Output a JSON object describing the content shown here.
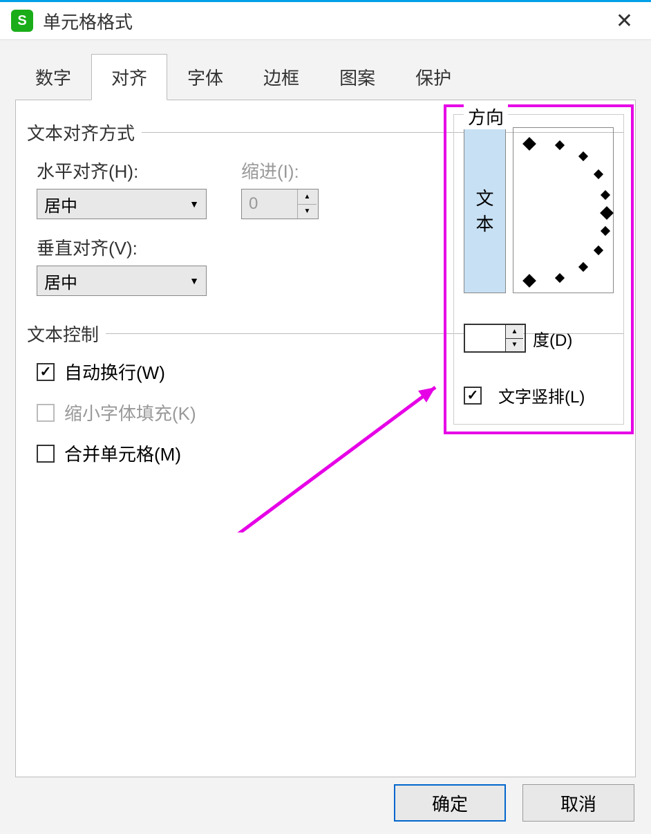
{
  "titlebar": {
    "app_icon_letter": "S",
    "title": "单元格格式"
  },
  "tabs": [
    "数字",
    "对齐",
    "字体",
    "边框",
    "图案",
    "保护"
  ],
  "active_tab_index": 1,
  "alignment": {
    "section_title": "文本对齐方式",
    "horizontal_label": "水平对齐(H):",
    "horizontal_value": "居中",
    "indent_label": "缩进(I):",
    "indent_value": "0",
    "vertical_label": "垂直对齐(V):",
    "vertical_value": "居中"
  },
  "text_control": {
    "section_title": "文本控制",
    "wrap_label": "自动换行(W)",
    "wrap_checked": true,
    "shrink_label": "缩小字体填充(K)",
    "shrink_checked": false,
    "shrink_disabled": true,
    "merge_label": "合并单元格(M)",
    "merge_checked": false
  },
  "orientation": {
    "legend": "方向",
    "vertical_text_sample": "文本",
    "degree_value": "",
    "degree_label": "度(D)",
    "vertical_layout_label": "文字竖排(L)",
    "vertical_layout_checked": true
  },
  "buttons": {
    "ok": "确定",
    "cancel": "取消"
  }
}
